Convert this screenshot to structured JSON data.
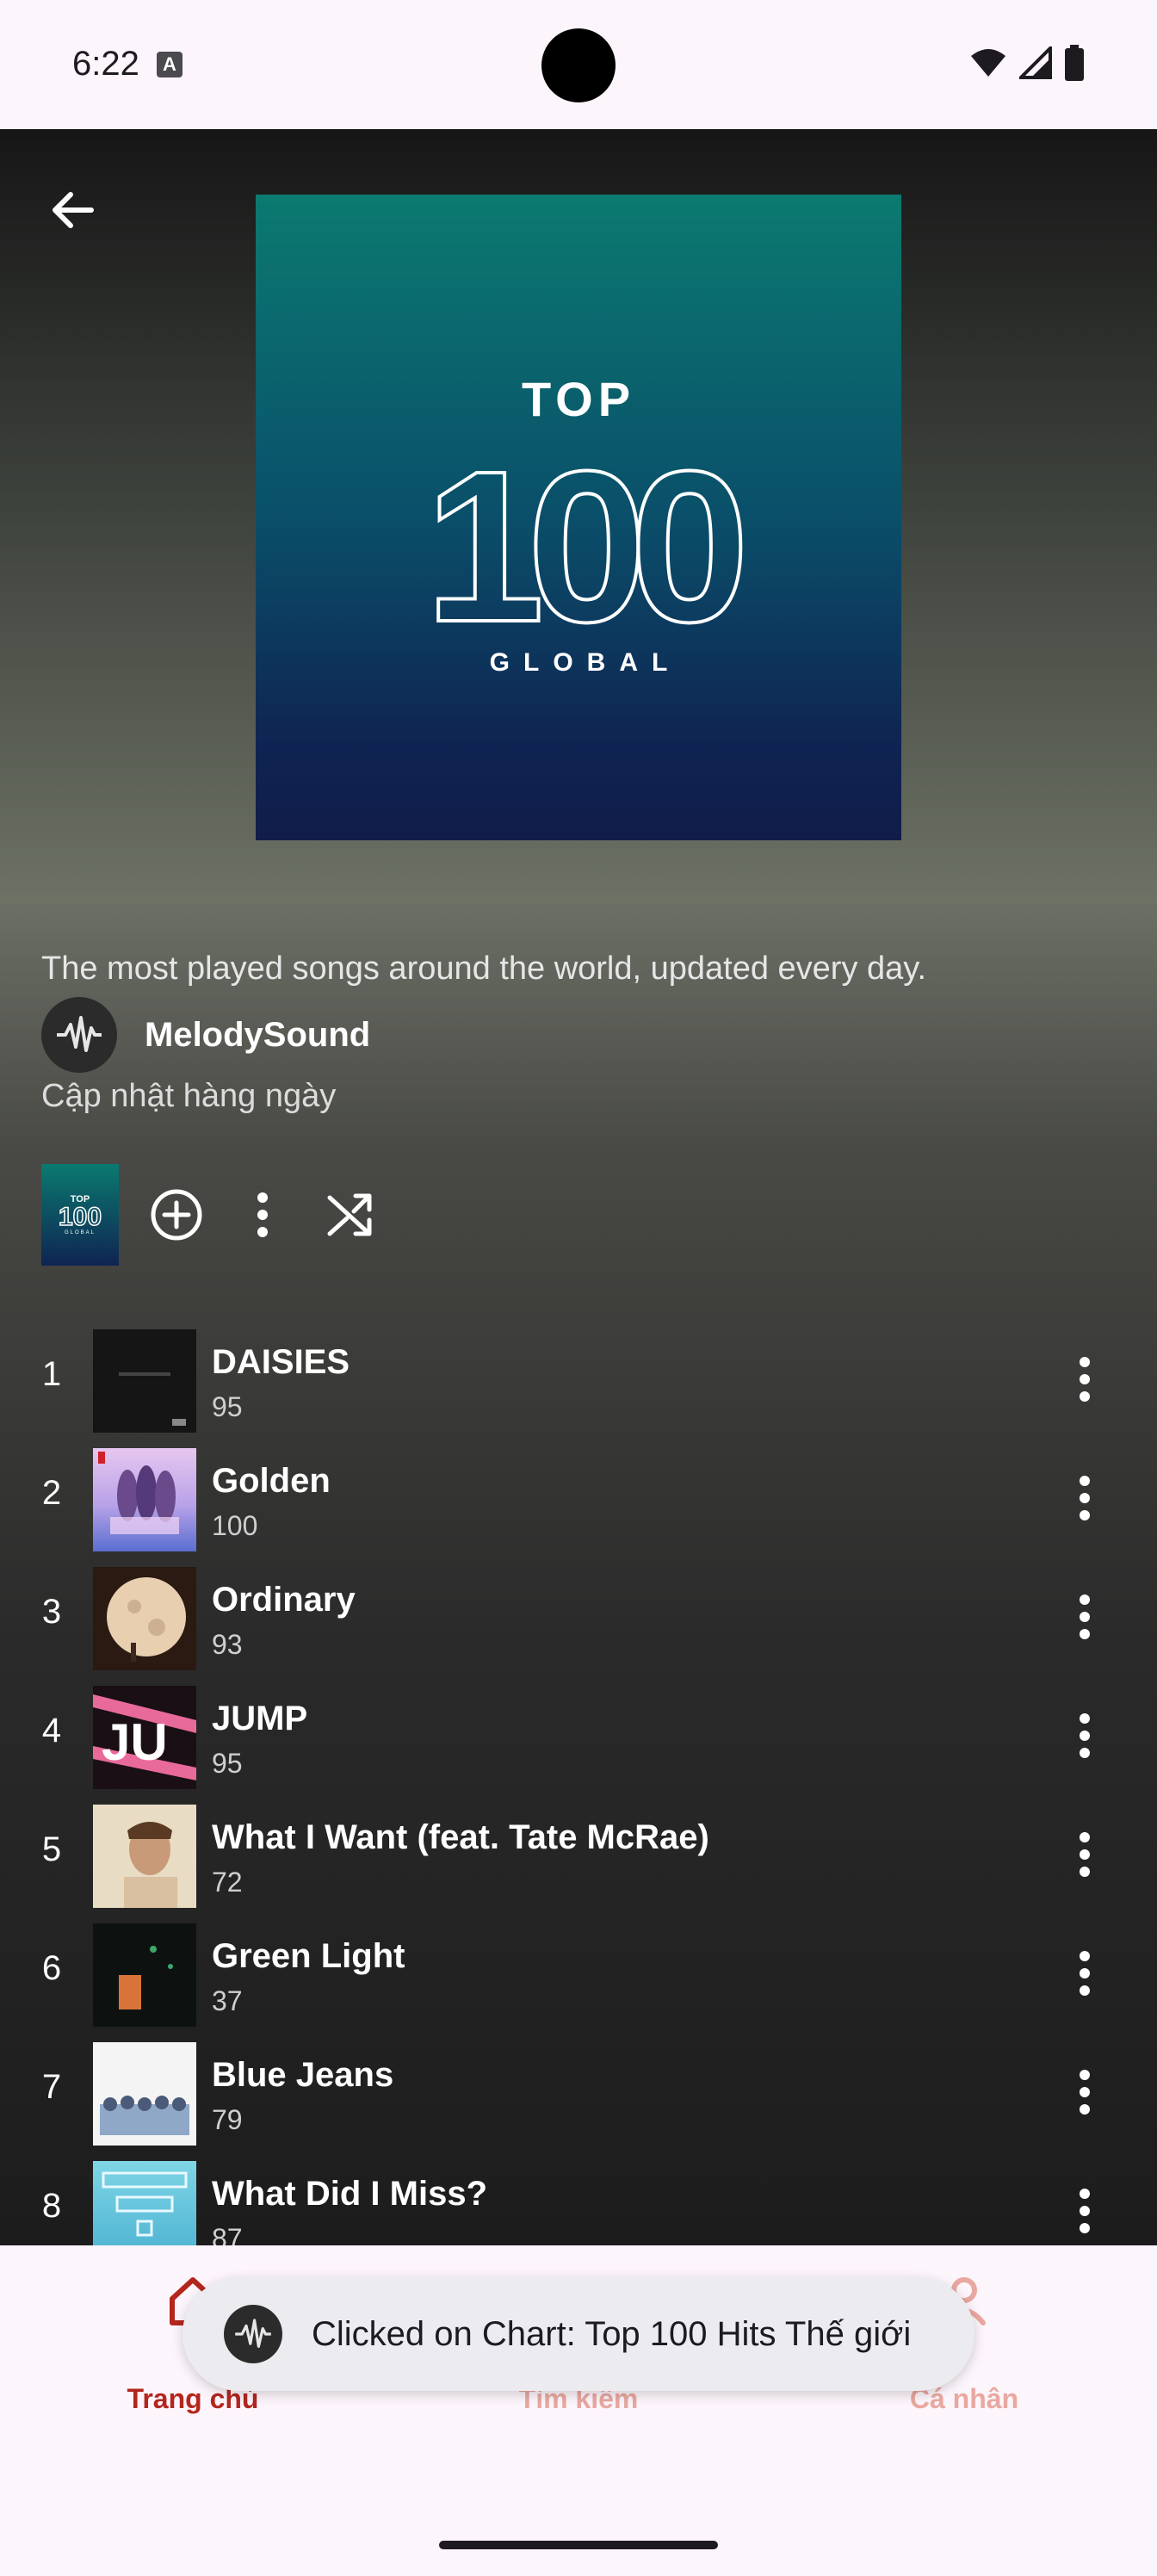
{
  "status_bar": {
    "time": "6:22",
    "notification_glyph": "A"
  },
  "header": {
    "back_icon": "arrow-left-icon"
  },
  "playlist": {
    "cover_top": "TOP",
    "cover_number": "100",
    "cover_subtitle": "GLOBAL",
    "description": "The most played songs around the world, updated every day.",
    "owner": "MelodySound",
    "update_frequency": "Cập nhật hàng ngày"
  },
  "actions": {
    "add_icon": "add-circle-icon",
    "more_icon": "more-vert-icon",
    "shuffle_icon": "shuffle-icon"
  },
  "songs": [
    {
      "rank": "1",
      "title": "DAISIES",
      "plays": "95"
    },
    {
      "rank": "2",
      "title": "Golden",
      "plays": "100"
    },
    {
      "rank": "3",
      "title": "Ordinary",
      "plays": "93"
    },
    {
      "rank": "4",
      "title": "JUMP",
      "plays": "95"
    },
    {
      "rank": "5",
      "title": "What I Want (feat. Tate McRae)",
      "plays": "72"
    },
    {
      "rank": "6",
      "title": "Green Light",
      "plays": "37"
    },
    {
      "rank": "7",
      "title": "Blue Jeans",
      "plays": "79"
    },
    {
      "rank": "8",
      "title": "What Did I Miss?",
      "plays": "87"
    }
  ],
  "bottom_nav": {
    "items": [
      {
        "label": "Trang chủ",
        "icon": "home-icon",
        "active": true
      },
      {
        "label": "Tìm kiếm",
        "icon": "search-icon",
        "active": false
      },
      {
        "label": "Cá nhân",
        "icon": "person-icon",
        "active": false
      }
    ]
  },
  "toast": {
    "message": "Clicked on Chart: Top 100 Hits Thế giới"
  },
  "colors": {
    "accent": "#b3261e",
    "inactive_nav": "#e8a8a0",
    "background": "#fcf5fb",
    "cover_top": "#0b7a70",
    "cover_bottom": "#111c4a"
  }
}
